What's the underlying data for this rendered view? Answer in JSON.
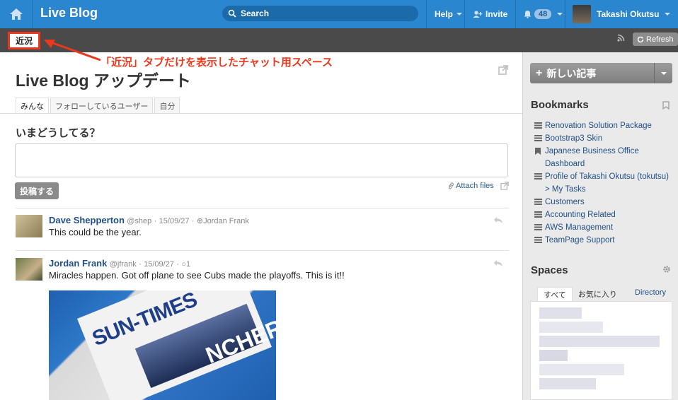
{
  "topbar": {
    "title": "Live Blog",
    "search_label": "Search",
    "help_label": "Help",
    "invite_label": "Invite",
    "notifications_count": "48",
    "user_name": "Takashi Okutsu"
  },
  "subbar": {
    "recent_tab_label": "近況",
    "refresh_label": "Refresh"
  },
  "annotation": "「近況」タブだけを表示したチャット用スペース",
  "main": {
    "page_title": "Live Blog アップデート",
    "tabs": [
      "みんな",
      "フォローしているユーザー",
      "自分"
    ],
    "prompt": "いまどうしてる？",
    "post_button": "投稿する",
    "attach_label": "Attach files"
  },
  "posts": [
    {
      "author": "Dave Shepperton",
      "handle": "@shep",
      "date": "15/09/27",
      "recipient": "Jordan Frank",
      "body": "This could be the year."
    },
    {
      "author": "Jordan Frank",
      "handle": "@jfrank",
      "date": "15/09/27",
      "comments": "1",
      "body": "Miracles happen. Got off plane to see Cubs made the playoffs. This is it!!"
    }
  ],
  "photo_text": {
    "masthead": "SUN-TIMES",
    "headline": "NCHER!"
  },
  "sidebar": {
    "new_post_label": "新しい記事",
    "bookmarks_title": "Bookmarks",
    "bookmarks": [
      "Renovation Solution Package",
      "Bootstrap3 Skin",
      "Japanese Business Office Dashboard",
      "Profile of Takashi Okutsu (tokutsu) > My Tasks",
      "Customers",
      "Accounting Related",
      "AWS Management",
      "TeamPage Support"
    ],
    "spaces_title": "Spaces",
    "spaces_tabs": [
      "すべて",
      "お気に入り"
    ],
    "directory_label": "Directory"
  },
  "colors": {
    "topbar": "#2a86cf",
    "subbar": "#4a4a4a",
    "annotation": "#e8391e",
    "link": "#1f4f86"
  }
}
